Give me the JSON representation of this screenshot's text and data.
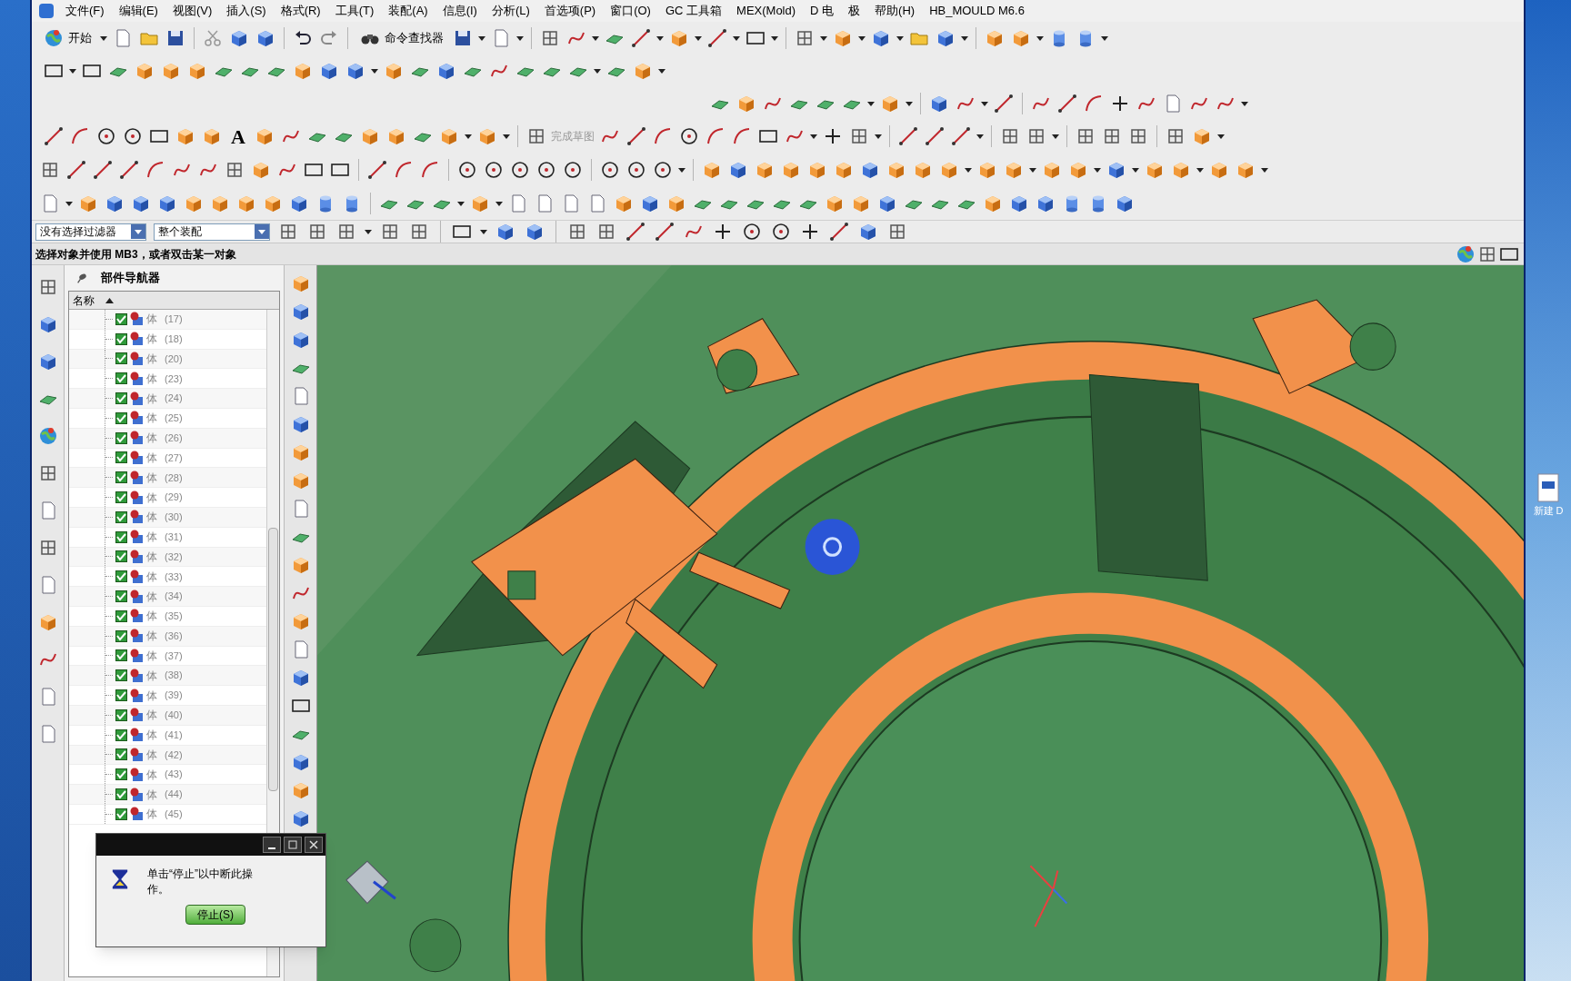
{
  "menu_bar": [
    "文件(F)",
    "编辑(E)",
    "视图(V)",
    "插入(S)",
    "格式(R)",
    "工具(T)",
    "装配(A)",
    "信息(I)",
    "分析(L)",
    "首选项(P)",
    "窗口(O)",
    "GC 工具箱",
    "MEX(Mold)",
    "D 电",
    "极",
    "帮助(H)",
    "HB_MOULD M6.6"
  ],
  "toolbar": {
    "start_button": "开始",
    "command_finder": "命令查找器",
    "text_tool": "A",
    "finish_sketch": {
      "label": "完成草图",
      "disabled": true
    }
  },
  "selection_bar": {
    "filter": "没有选择过滤器",
    "scope": "整个装配"
  },
  "status_line": "选择对象并使用 MB3，或者双击某一对象",
  "part_navigator": {
    "title": "部件导航器",
    "column": "名称",
    "rows": [
      {
        "label": "体",
        "number": "(17)",
        "checked": true
      },
      {
        "label": "体",
        "number": "(18)",
        "checked": true
      },
      {
        "label": "体",
        "number": "(20)",
        "checked": true
      },
      {
        "label": "体",
        "number": "(23)",
        "checked": true
      },
      {
        "label": "体",
        "number": "(24)",
        "checked": true
      },
      {
        "label": "体",
        "number": "(25)",
        "checked": true
      },
      {
        "label": "体",
        "number": "(26)",
        "checked": true
      },
      {
        "label": "体",
        "number": "(27)",
        "checked": true
      },
      {
        "label": "体",
        "number": "(28)",
        "checked": true
      },
      {
        "label": "体",
        "number": "(29)",
        "checked": true
      },
      {
        "label": "体",
        "number": "(30)",
        "checked": true
      },
      {
        "label": "体",
        "number": "(31)",
        "checked": true
      },
      {
        "label": "体",
        "number": "(32)",
        "checked": true
      },
      {
        "label": "体",
        "number": "(33)",
        "checked": true
      },
      {
        "label": "体",
        "number": "(34)",
        "checked": true
      },
      {
        "label": "体",
        "number": "(35)",
        "checked": true
      },
      {
        "label": "体",
        "number": "(36)",
        "checked": true
      },
      {
        "label": "体",
        "number": "(37)",
        "checked": true
      },
      {
        "label": "体",
        "number": "(38)",
        "checked": true
      },
      {
        "label": "体",
        "number": "(39)",
        "checked": true
      },
      {
        "label": "体",
        "number": "(40)",
        "checked": true
      },
      {
        "label": "体",
        "number": "(41)",
        "checked": true
      },
      {
        "label": "体",
        "number": "(42)",
        "checked": true
      },
      {
        "label": "体",
        "number": "(43)",
        "checked": true
      },
      {
        "label": "体",
        "number": "(44)",
        "checked": true
      },
      {
        "label": "体",
        "number": "(45)",
        "checked": true
      }
    ]
  },
  "progress_dialog": {
    "message": "单击“停止”以中断此操作。",
    "button": "停止(S)"
  },
  "desktop": {
    "icon_label": "新建 D"
  }
}
